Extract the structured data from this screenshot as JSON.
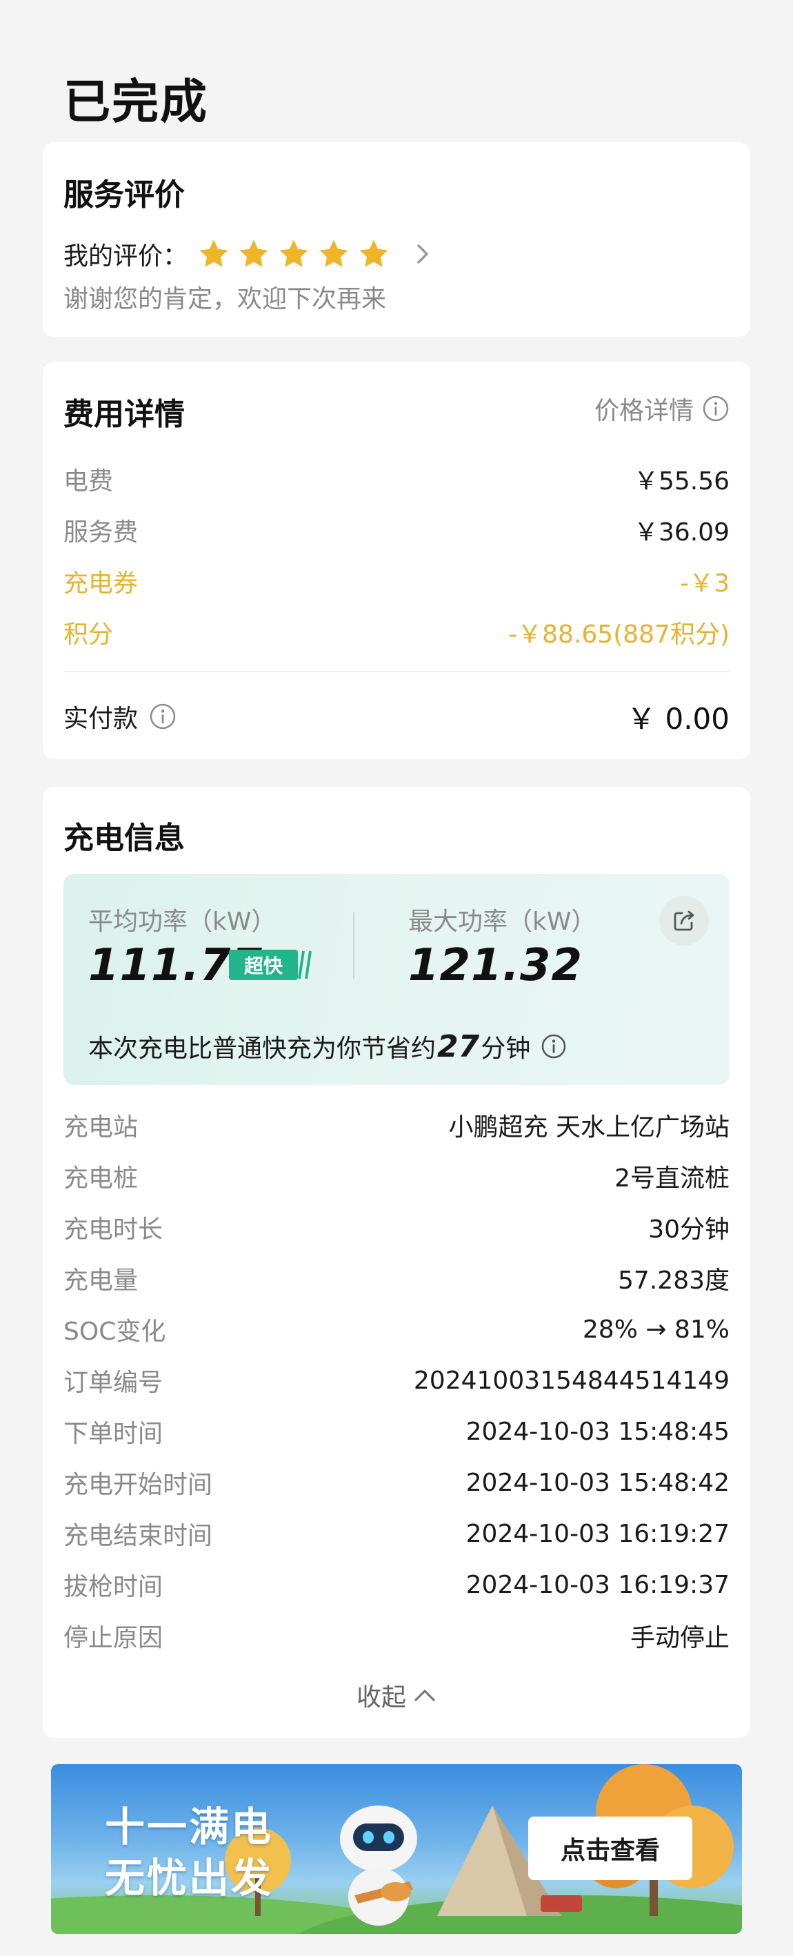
{
  "page": {
    "status_title": "已完成"
  },
  "review": {
    "title": "服务评价",
    "label": "我的评价：",
    "rating": 5,
    "rating_max": 5,
    "message": "谢谢您的肯定，欢迎下次再来"
  },
  "fees": {
    "title": "费用详情",
    "price_detail_link": "价格详情",
    "rows": [
      {
        "label": "电费",
        "value": "￥55.56"
      },
      {
        "label": "服务费",
        "value": "￥36.09"
      },
      {
        "label": "充电券",
        "value": "-￥3"
      },
      {
        "label": "积分",
        "value": "-￥88.65(887积分)"
      }
    ],
    "paid_label": "实付款",
    "paid_value": "￥ 0.00"
  },
  "charge": {
    "title": "充电信息",
    "avg_power_label": "平均功率（kW）",
    "avg_power_value": "111.77",
    "fast_badge": "超快",
    "max_power_label": "最大功率（kW）",
    "max_power_value": "121.32",
    "saving_prefix": "本次充电比普通快充为你节省约",
    "saving_minutes": "27",
    "saving_suffix": "分钟",
    "rows": [
      {
        "label": "充电站",
        "value": "小鹏超充  天水上亿广场站"
      },
      {
        "label": "充电桩",
        "value": "2号直流桩"
      },
      {
        "label": "充电时长",
        "value": "30分钟"
      },
      {
        "label": "充电量",
        "value": "57.283度"
      },
      {
        "label": "SOC变化",
        "value": "28%  →  81%"
      },
      {
        "label": "订单编号",
        "value": "20241003154844514149"
      },
      {
        "label": "下单时间",
        "value": "2024-10-03  15:48:45"
      },
      {
        "label": "充电开始时间",
        "value": "2024-10-03  15:48:42"
      },
      {
        "label": "充电结束时间",
        "value": "2024-10-03  16:19:27"
      },
      {
        "label": "拔枪时间",
        "value": "2024-10-03  16:19:37"
      },
      {
        "label": "停止原因",
        "value": "手动停止"
      }
    ],
    "collapse_label": "收起"
  },
  "banner": {
    "line1": "十一满电",
    "line2": "无忧出发",
    "cta": "点击查看"
  },
  "colors": {
    "accent_gold": "#e7b32f",
    "badge_green": "#22b48a",
    "muted_text": "#8a8a8a"
  },
  "icons": {
    "star": "star-icon",
    "chevron": "chevron-right-icon",
    "info": "info-icon",
    "share": "share-icon",
    "collapse": "chevron-up-icon"
  }
}
